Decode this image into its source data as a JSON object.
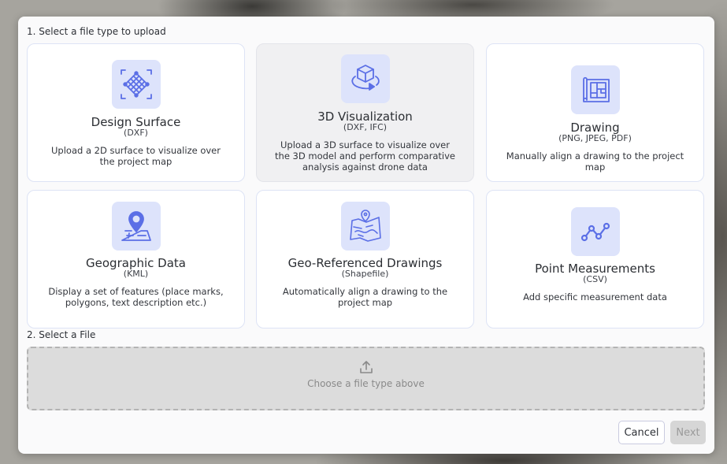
{
  "steps": {
    "step1_label": "1. Select a file type to upload",
    "step2_label": "2. Select a File"
  },
  "file_types": [
    {
      "title": "Design Surface",
      "formats": "(DXF)",
      "description": "Upload a 2D surface to visualize over the project map",
      "icon": "mesh-surface-icon",
      "selected": false
    },
    {
      "title": "3D Visualization",
      "formats": "(DXF, IFC)",
      "description": "Upload a 3D surface to visualize over the 3D model and perform comparative analysis against drone data",
      "icon": "cube-rotate-icon",
      "selected": true
    },
    {
      "title": "Drawing",
      "formats": "(PNG, JPEG, PDF)",
      "description": "Manually align a drawing to the project map",
      "icon": "blueprint-icon",
      "selected": false
    },
    {
      "title": "Geographic Data",
      "formats": "(KML)",
      "description": "Display a set of features (place marks, polygons, text description etc.)",
      "icon": "map-pin-icon",
      "selected": false
    },
    {
      "title": "Geo-Referenced Drawings",
      "formats": "(Shapefile)",
      "description": "Automatically align a drawing to the project map",
      "icon": "geo-map-icon",
      "selected": false
    },
    {
      "title": "Point Measurements",
      "formats": "(CSV)",
      "description": "Add specific measurement data",
      "icon": "line-points-icon",
      "selected": false
    }
  ],
  "dropzone": {
    "hint": "Choose a file type above",
    "icon": "upload-icon"
  },
  "footer": {
    "cancel_label": "Cancel",
    "next_label": "Next",
    "next_disabled": true
  },
  "colors": {
    "icon_tile": "#dde3fb",
    "icon_stroke": "#5b6fe6",
    "card_border": "#dde3f5",
    "selected_card": "#f0f0f2"
  }
}
